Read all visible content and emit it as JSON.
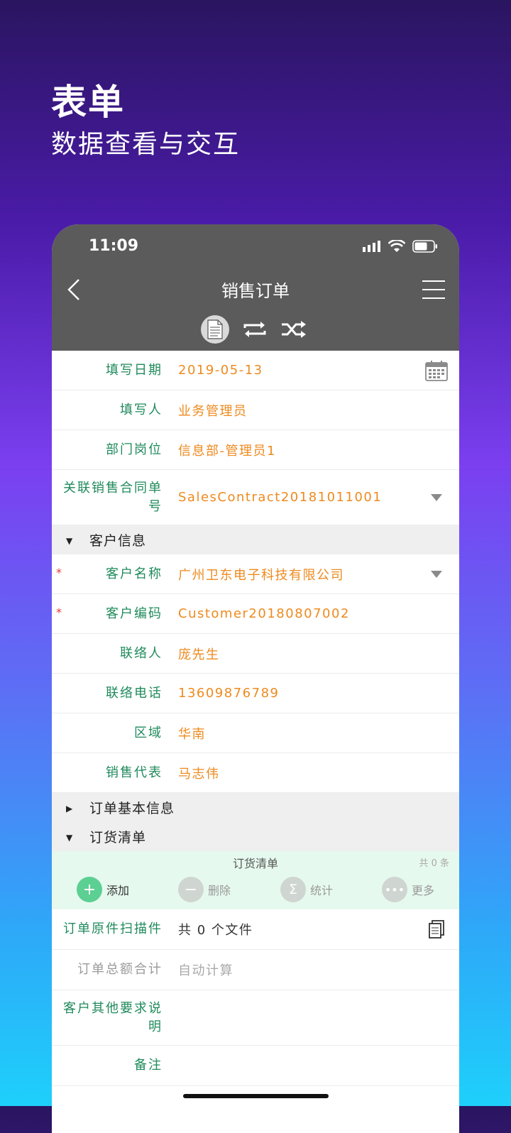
{
  "promo": {
    "title": "表单",
    "subtitle": "数据查看与交互"
  },
  "status_bar": {
    "time": "11:09",
    "icons": [
      "signal-icon",
      "wifi-icon",
      "battery-icon"
    ]
  },
  "nav": {
    "title": "销售订单",
    "back_icon": "back-chevron-icon",
    "menu_icon": "hamburger-menu-icon"
  },
  "toolbar": {
    "icons": [
      "document-icon",
      "repeat-icon",
      "shuffle-icon"
    ]
  },
  "form": {
    "fill_date": {
      "label": "填写日期",
      "value": "2019-05-13"
    },
    "filler": {
      "label": "填写人",
      "value": "业务管理员"
    },
    "department": {
      "label": "部门岗位",
      "value": "信息部-管理员1"
    },
    "contract": {
      "label": "关联销售合同单号",
      "value": "SalesContract20181011001"
    }
  },
  "customer_section": {
    "title": "客户信息",
    "name": {
      "label": "客户名称",
      "value": "广州卫东电子科技有限公司",
      "required": "*"
    },
    "code": {
      "label": "客户编码",
      "value": "Customer20180807002",
      "required": "*"
    },
    "contact": {
      "label": "联络人",
      "value": "庞先生"
    },
    "phone": {
      "label": "联络电话",
      "value": "13609876789"
    },
    "region": {
      "label": "区域",
      "value": "华南"
    },
    "sales_rep": {
      "label": "销售代表",
      "value": "马志伟"
    }
  },
  "order_basic_section": {
    "title": "订单基本信息"
  },
  "order_list_section": {
    "title": "订货清单",
    "panel_title": "订货清单",
    "count": "共 0 条",
    "actions": {
      "add": "添加",
      "delete": "删除",
      "stats": "统计",
      "more": "更多"
    }
  },
  "extra": {
    "scan": {
      "label": "订单原件扫描件",
      "value": "共 0 个文件"
    },
    "total": {
      "label": "订单总额合计",
      "value": "自动计算"
    },
    "requirements": {
      "label": "客户其他要求说明",
      "value": ""
    },
    "remark": {
      "label": "备注",
      "value": ""
    }
  },
  "colors": {
    "label_green": "#1f8a5b",
    "value_orange": "#ee8a1e",
    "header_gray": "#5b5b5b",
    "add_green": "#5ccf92"
  }
}
